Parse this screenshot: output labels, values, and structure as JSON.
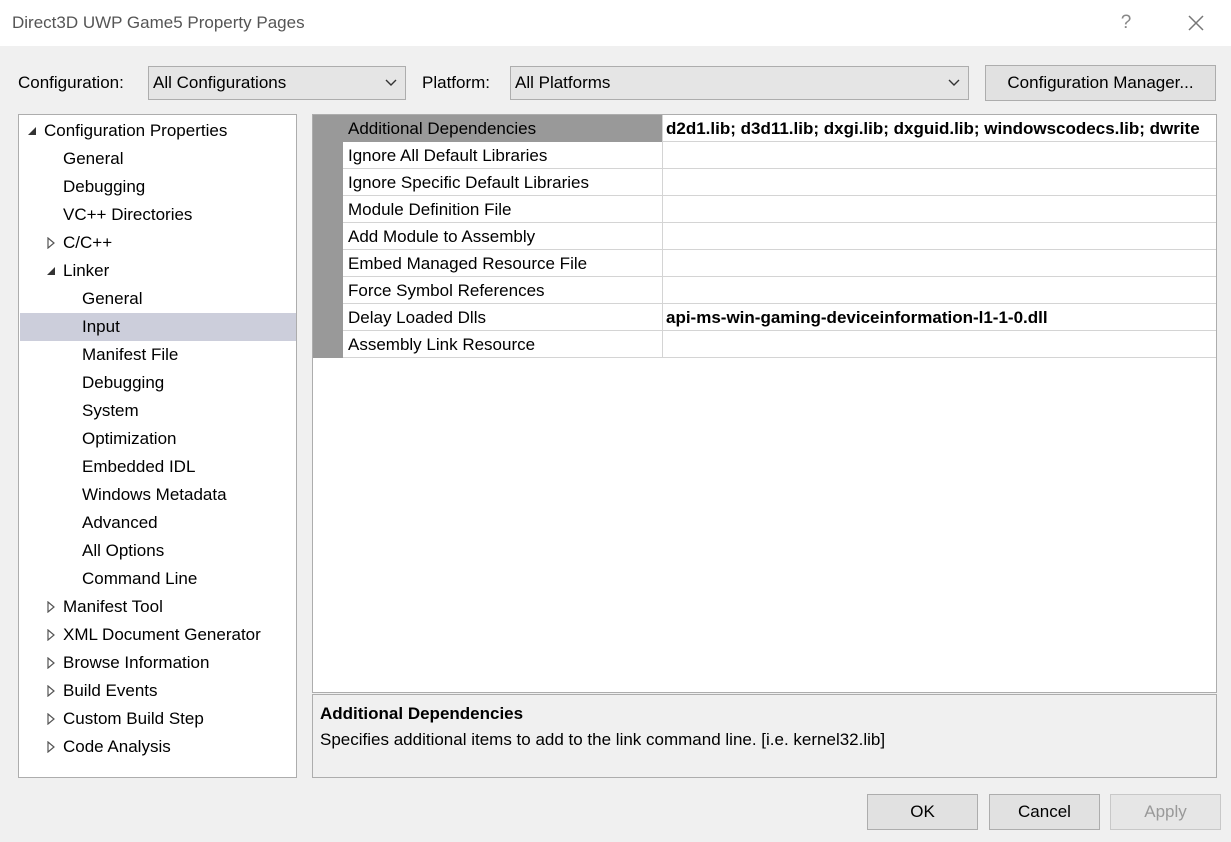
{
  "window": {
    "title": "Direct3D UWP Game5 Property Pages",
    "help_icon": "question-mark-icon",
    "close_icon": "close-icon"
  },
  "toolbar": {
    "configuration_label": "Configuration:",
    "configuration_value": "All Configurations",
    "platform_label": "Platform:",
    "platform_value": "All Platforms",
    "config_manager_label": "Configuration Manager..."
  },
  "tree": {
    "items": [
      {
        "label": "Configuration Properties",
        "expander": "expanded"
      },
      {
        "label": "General",
        "expander": "none"
      },
      {
        "label": "Debugging",
        "expander": "none"
      },
      {
        "label": "VC++ Directories",
        "expander": "none"
      },
      {
        "label": "C/C++",
        "expander": "collapsed"
      },
      {
        "label": "Linker",
        "expander": "expanded"
      },
      {
        "label": "General",
        "expander": "none"
      },
      {
        "label": "Input",
        "expander": "none",
        "selected": true
      },
      {
        "label": "Manifest File",
        "expander": "none"
      },
      {
        "label": "Debugging",
        "expander": "none"
      },
      {
        "label": "System",
        "expander": "none"
      },
      {
        "label": "Optimization",
        "expander": "none"
      },
      {
        "label": "Embedded IDL",
        "expander": "none"
      },
      {
        "label": "Windows Metadata",
        "expander": "none"
      },
      {
        "label": "Advanced",
        "expander": "none"
      },
      {
        "label": "All Options",
        "expander": "none"
      },
      {
        "label": "Command Line",
        "expander": "none"
      },
      {
        "label": "Manifest Tool",
        "expander": "collapsed"
      },
      {
        "label": "XML Document Generator",
        "expander": "collapsed"
      },
      {
        "label": "Browse Information",
        "expander": "collapsed"
      },
      {
        "label": "Build Events",
        "expander": "collapsed"
      },
      {
        "label": "Custom Build Step",
        "expander": "collapsed"
      },
      {
        "label": "Code Analysis",
        "expander": "collapsed"
      }
    ]
  },
  "grid": {
    "rows": [
      {
        "name": "Additional Dependencies",
        "value": "d2d1.lib; d3d11.lib; dxgi.lib; dxguid.lib; windowscodecs.lib; dwrite",
        "selected": true
      },
      {
        "name": "Ignore All Default Libraries",
        "value": ""
      },
      {
        "name": "Ignore Specific Default Libraries",
        "value": ""
      },
      {
        "name": "Module Definition File",
        "value": ""
      },
      {
        "name": "Add Module to Assembly",
        "value": ""
      },
      {
        "name": "Embed Managed Resource File",
        "value": ""
      },
      {
        "name": "Force Symbol References",
        "value": ""
      },
      {
        "name": "Delay Loaded Dlls",
        "value": "api-ms-win-gaming-deviceinformation-l1-1-0.dll"
      },
      {
        "name": "Assembly Link Resource",
        "value": ""
      }
    ]
  },
  "description": {
    "title": "Additional Dependencies",
    "text": "Specifies additional items to add to the link command line. [i.e. kernel32.lib]"
  },
  "buttons": {
    "ok": "OK",
    "cancel": "Cancel",
    "apply": "Apply"
  },
  "colors": {
    "selected_tree_bg": "#cccedb",
    "grid_gutter": "#999999"
  }
}
